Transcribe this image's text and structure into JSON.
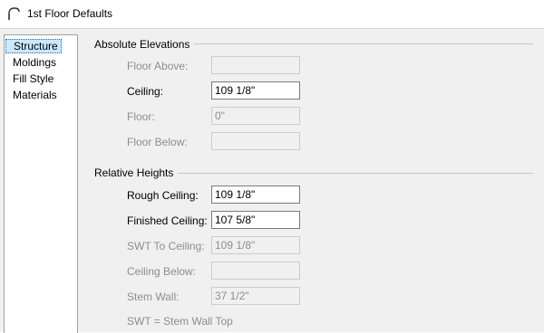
{
  "window": {
    "title": "1st Floor Defaults",
    "icon": "arch-icon"
  },
  "nav": {
    "items": [
      {
        "label": "Structure",
        "selected": true
      },
      {
        "label": "Moldings"
      },
      {
        "label": "Fill Style"
      },
      {
        "label": "Materials"
      }
    ]
  },
  "absolute": {
    "header": "Absolute Elevations",
    "floor_above": {
      "label": "Floor Above:",
      "value": ""
    },
    "ceiling": {
      "label": "Ceiling:",
      "value": "109 1/8\""
    },
    "floor": {
      "label": "Floor:",
      "value": "0\""
    },
    "floor_below": {
      "label": "Floor Below:",
      "value": ""
    }
  },
  "relative": {
    "header": "Relative Heights",
    "rough_ceiling": {
      "label": "Rough Ceiling:",
      "value": "109 1/8\""
    },
    "finished_ceiling": {
      "label": "Finished Ceiling:",
      "value": "107 5/8\""
    },
    "swt_to_ceiling": {
      "label": "SWT To Ceiling:",
      "value": "109 1/8\""
    },
    "ceiling_below": {
      "label": "Ceiling Below:",
      "value": ""
    },
    "stem_wall": {
      "label": "Stem Wall:",
      "value": "37 1/2\""
    }
  },
  "footnote": "SWT = Stem Wall Top",
  "colors": {
    "selection": "#cce8ff",
    "disabled_text": "#8d8d8d",
    "panel": "#f0f0f0"
  }
}
